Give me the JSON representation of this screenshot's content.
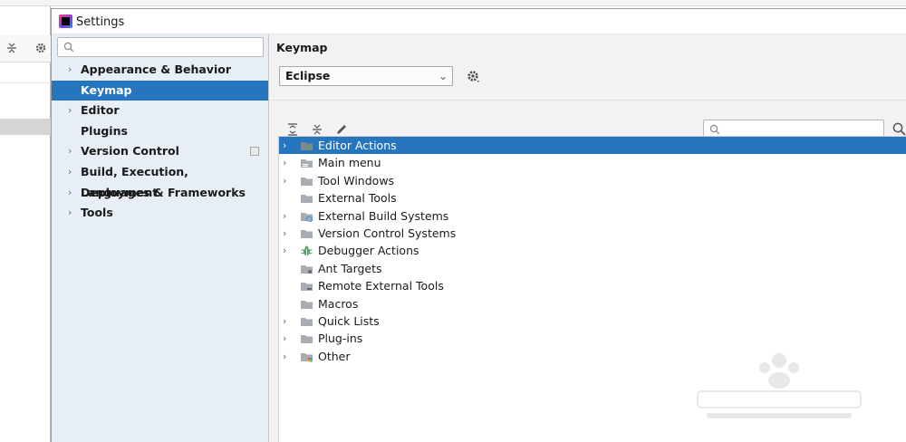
{
  "window": {
    "title": "Settings"
  },
  "nav": {
    "search_placeholder": "",
    "items": [
      {
        "label": "Appearance & Behavior",
        "expandable": true
      },
      {
        "label": "Keymap",
        "expandable": false,
        "selected": true
      },
      {
        "label": "Editor",
        "expandable": true
      },
      {
        "label": "Plugins",
        "expandable": false
      },
      {
        "label": "Version Control",
        "expandable": true,
        "project_icon": true
      },
      {
        "label": "Build, Execution, Deployment",
        "expandable": true
      },
      {
        "label": "Languages & Frameworks",
        "expandable": true
      },
      {
        "label": "Tools",
        "expandable": true
      }
    ]
  },
  "keymap": {
    "panel_title": "Keymap",
    "selected_scheme": "Eclipse",
    "filter_placeholder": "",
    "actions": [
      {
        "label": "Editor Actions",
        "expandable": true,
        "icon": "editor-actions-icon",
        "selected": true
      },
      {
        "label": "Main menu",
        "expandable": true,
        "icon": "menu-folder-icon"
      },
      {
        "label": "Tool Windows",
        "expandable": true,
        "icon": "folder-icon"
      },
      {
        "label": "External Tools",
        "expandable": false,
        "icon": "folder-icon"
      },
      {
        "label": "External Build Systems",
        "expandable": true,
        "icon": "build-gear-folder-icon"
      },
      {
        "label": "Version Control Systems",
        "expandable": true,
        "icon": "folder-icon"
      },
      {
        "label": "Debugger Actions",
        "expandable": true,
        "icon": "bug-icon"
      },
      {
        "label": "Ant Targets",
        "expandable": false,
        "icon": "ant-folder-icon"
      },
      {
        "label": "Remote External Tools",
        "expandable": false,
        "icon": "remote-folder-icon"
      },
      {
        "label": "Macros",
        "expandable": false,
        "icon": "folder-icon"
      },
      {
        "label": "Quick Lists",
        "expandable": true,
        "icon": "folder-icon"
      },
      {
        "label": "Plug-ins",
        "expandable": true,
        "icon": "folder-icon"
      },
      {
        "label": "Other",
        "expandable": true,
        "icon": "other-folder-icon"
      }
    ]
  },
  "colors": {
    "selection": "#2675bf",
    "nav_background": "#e8eef6",
    "folder": "#a8adb3"
  }
}
